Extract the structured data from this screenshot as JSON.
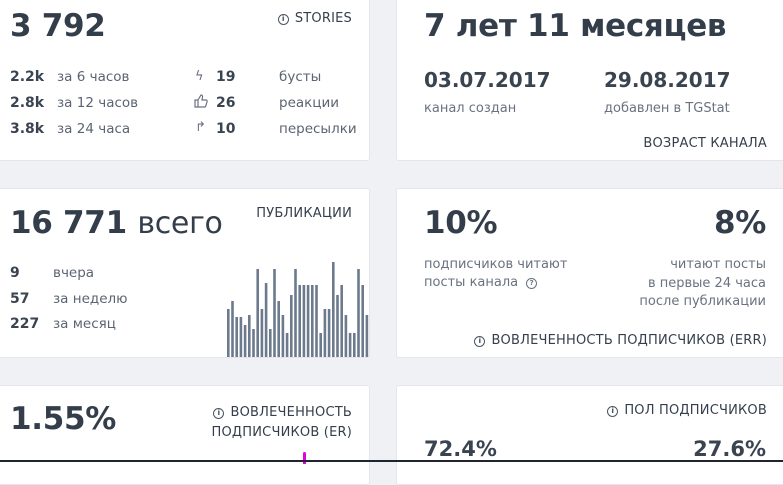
{
  "stories_card": {
    "total": "3 792",
    "header": "STORIES",
    "rows": [
      {
        "value": "2.2k",
        "label": "за 6 часов"
      },
      {
        "value": "2.8k",
        "label": "за 12 часов"
      },
      {
        "value": "3.8k",
        "label": "за 24 часа"
      }
    ],
    "stats": [
      {
        "icon": "lightning-icon",
        "glyph": "ϟ",
        "value": "19",
        "label": "бусты"
      },
      {
        "icon": "thumbs-up-icon",
        "glyph": "👍",
        "value": "26",
        "label": "реакции"
      },
      {
        "icon": "forward-arrow-icon",
        "glyph": "↱",
        "value": "10",
        "label": "пересылки"
      }
    ]
  },
  "age_card": {
    "age": "7 лет 11 месяцев",
    "created_date": "03.07.2017",
    "created_label": "канал создан",
    "added_date": "29.08.2017",
    "added_label": "добавлен в TGStat",
    "header": "ВОЗРАСТ КАНАЛА"
  },
  "publications_card": {
    "total": "16 771",
    "total_suffix": "всего",
    "header": "ПУБЛИКАЦИИ",
    "rows": [
      {
        "value": "9",
        "label": "вчера"
      },
      {
        "value": "57",
        "label": "за неделю"
      },
      {
        "value": "227",
        "label": "за месяц"
      }
    ],
    "bar_color": "#6b7a8c"
  },
  "err_card": {
    "left_value": "10%",
    "left_text_1": "подписчиков читают",
    "left_text_2": "посты канала",
    "right_value": "8%",
    "right_text_1": "читают посты",
    "right_text_2": "в первые 24 часа",
    "right_text_3": "после публикации",
    "header": "ВОВЛЕЧЕННОСТЬ ПОДПИСЧИКОВ (ERR)"
  },
  "er_card": {
    "value": "1.55%",
    "header_1": "ВОВЛЕЧЕННОСТЬ",
    "header_2": "ПОДПИСЧИКОВ (ER)",
    "accent": "#e000e0"
  },
  "gender_card": {
    "header": "ПОЛ ПОДПИСЧИКОВ",
    "left_value": "72.4%",
    "right_value": "27.6%"
  },
  "chart_data": {
    "type": "bar",
    "values": [
      48,
      56,
      40,
      40,
      32,
      42,
      28,
      88,
      48,
      74,
      28,
      88,
      56,
      42,
      24,
      62,
      88,
      72,
      72,
      72,
      72,
      72,
      24,
      48,
      48,
      95,
      62,
      72,
      42,
      24,
      24,
      88,
      72,
      42
    ]
  }
}
